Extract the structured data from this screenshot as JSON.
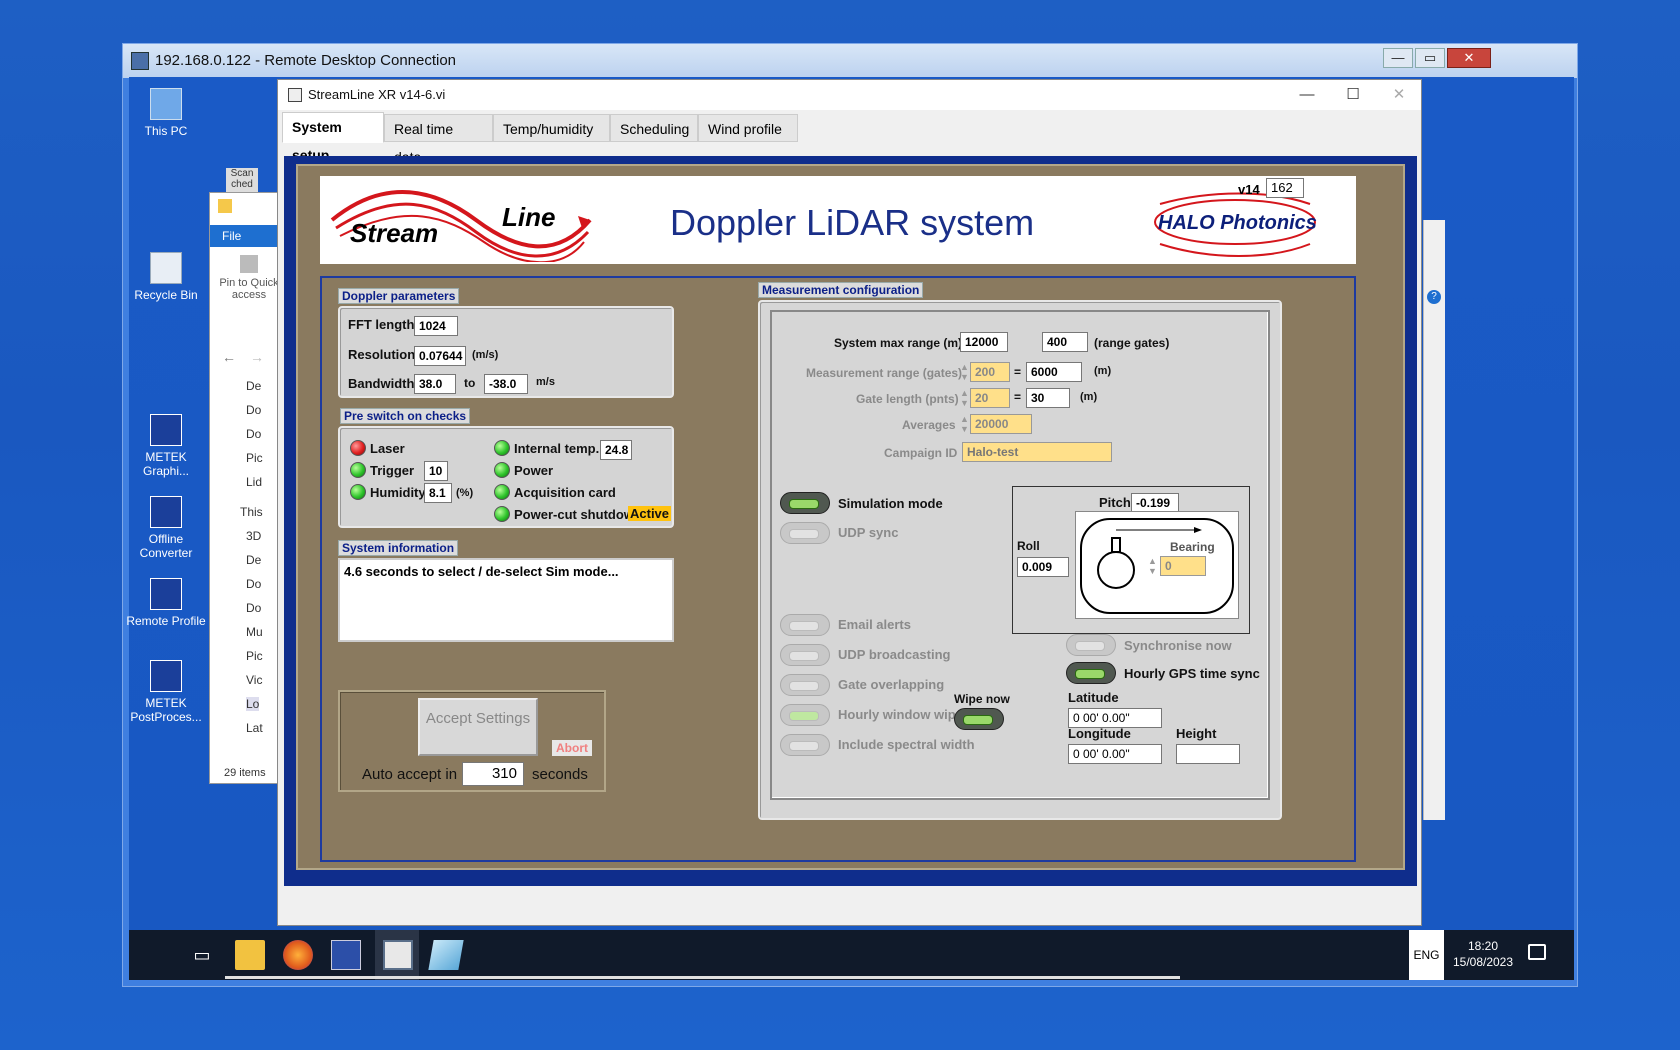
{
  "rdc": {
    "title": "192.168.0.122 - Remote Desktop Connection",
    "min": "—",
    "max": "▭",
    "close": "✕"
  },
  "desktop": {
    "icons": [
      {
        "label": "This PC"
      },
      {
        "label": "Scan ched"
      },
      {
        "label": "Recycle Bin"
      },
      {
        "label": "METEK Graphi..."
      },
      {
        "label": "Offline Converter"
      },
      {
        "label": "Remote Profile"
      },
      {
        "label": "METEK PostProces..."
      }
    ]
  },
  "explorer": {
    "file_tab": "File",
    "pin_label": "Pin to Quick access",
    "items": [
      "De",
      "Do",
      "Do",
      "Pic",
      "Lid",
      "This",
      "3D",
      "De",
      "Do",
      "Do",
      "Mu",
      "Pic",
      "Vic",
      "Lo",
      "Lat"
    ],
    "status": "29 items"
  },
  "app": {
    "title": "StreamLine XR v14-6.vi",
    "tabs": [
      "System setup",
      "Real time data",
      "Temp/humidity",
      "Scheduling",
      "Wind profile"
    ],
    "banner": {
      "logo_stream": "Stream",
      "logo_line": "Line",
      "title": "Doppler LiDAR system",
      "brand": "HALO Photonics",
      "version_label": "v14",
      "version_value": "162"
    },
    "doppler": {
      "label": "Doppler parameters",
      "fft_label": "FFT length",
      "fft_value": "1024",
      "res_label": "Resolution",
      "res_value": "0.07644",
      "res_unit": "(m/s)",
      "bw_label": "Bandwidth",
      "bw_from": "38.0",
      "bw_to_label": "to",
      "bw_to": "-38.0",
      "bw_unit": "m/s"
    },
    "checks": {
      "label": "Pre switch on checks",
      "laser": "Laser",
      "trigger": "Trigger",
      "trigger_value": "10",
      "humidity": "Humidity",
      "humidity_value": "8.1",
      "humidity_unit": "(%)",
      "internal_temp": "Internal temp.",
      "internal_temp_value": "24.8",
      "power": "Power",
      "acq": "Acquisition card",
      "powercut": "Power-cut shutdown",
      "powercut_state": "Active"
    },
    "sysinfo": {
      "label": "System information",
      "text": "4.6 seconds to select / de-select Sim mode..."
    },
    "accept": {
      "button": "Accept Settings",
      "abort": "Abort",
      "auto_label": "Auto accept in",
      "auto_value": "310",
      "auto_unit": "seconds"
    },
    "meas": {
      "label": "Measurement configuration",
      "max_range_label": "System max range (m)",
      "max_range_value": "12000",
      "range_gates_value": "400",
      "range_gates_unit": "(range gates)",
      "meas_range_label": "Measurement range (gates)",
      "meas_range_value": "200",
      "eq1": "=",
      "meas_range_m": "6000",
      "m_unit1": "(m)",
      "gate_len_label": "Gate length (pnts)",
      "gate_len_value": "20",
      "eq2": "=",
      "gate_len_m": "30",
      "m_unit2": "(m)",
      "averages_label": "Averages",
      "averages_value": "20000",
      "campaign_label": "Campaign ID",
      "campaign_value": "Halo-test",
      "sim_mode": "Simulation mode",
      "udp_sync": "UDP sync",
      "email_alerts": "Email alerts",
      "udp_broadcasting": "UDP broadcasting",
      "gate_overlapping": "Gate overlapping",
      "hourly_wipe": "Hourly window wipe",
      "wipe_now": "Wipe now",
      "spectral_width": "Include spectral width",
      "pitch_label": "Pitch",
      "pitch_value": "-0.199",
      "roll_label": "Roll",
      "roll_value": "0.009",
      "bearing_label": "Bearing",
      "bearing_value": "0",
      "sync_now": "Synchronise now",
      "gps_sync": "Hourly GPS time sync",
      "latitude_label": "Latitude",
      "latitude_value": "0 00' 0.00\"",
      "longitude_label": "Longitude",
      "longitude_value": "0 00' 0.00\"",
      "height_label": "Height",
      "height_value": ""
    }
  },
  "taskbar": {
    "lang": "ENG",
    "time": "18:20",
    "date": "15/08/2023"
  }
}
